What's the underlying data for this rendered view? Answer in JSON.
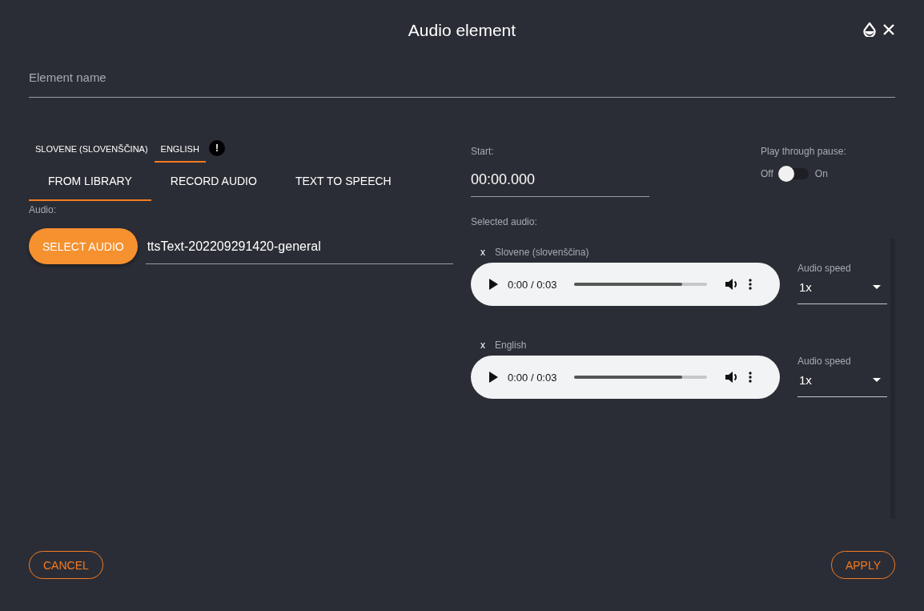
{
  "dialog": {
    "title": "Audio element"
  },
  "element_name": {
    "placeholder": "Element name"
  },
  "language_tabs": [
    {
      "label": "SLOVENE (SLOVENŠČINA)",
      "selected": false
    },
    {
      "label": "ENGLISH",
      "selected": true,
      "alert": "!"
    }
  ],
  "source_tabs": [
    {
      "label": "FROM LIBRARY",
      "selected": true
    },
    {
      "label": "RECORD AUDIO",
      "selected": false
    },
    {
      "label": "TEXT TO SPEECH",
      "selected": false
    }
  ],
  "audio": {
    "label": "Audio:",
    "button": "SELECT AUDIO",
    "value": "ttsText-202209291420-general"
  },
  "start": {
    "label": "Start:",
    "value": "00:00.000"
  },
  "play_through_pause": {
    "label": "Play through pause:",
    "off_label": "Off",
    "on_label": "On",
    "on": false
  },
  "selected_audio": {
    "label": "Selected audio:",
    "items": [
      {
        "remove": "x",
        "language": "Slovene (slovenščina)",
        "time": "0:00 / 0:03",
        "level": 0.81,
        "speed_label": "Audio speed",
        "speed": "1x"
      },
      {
        "remove": "x",
        "language": "English",
        "time": "0:00 / 0:03",
        "level": 0.81,
        "speed_label": "Audio speed",
        "speed": "1x"
      }
    ]
  },
  "buttons": {
    "cancel": "CANCEL",
    "apply": "APPLY"
  }
}
